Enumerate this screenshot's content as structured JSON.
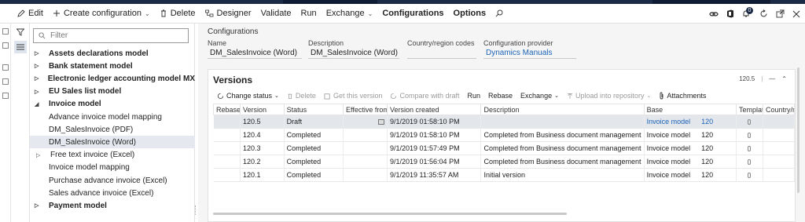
{
  "toolbar": {
    "edit": "Edit",
    "create_configuration": "Create configuration",
    "delete": "Delete",
    "designer": "Designer",
    "validate": "Validate",
    "run": "Run",
    "exchange": "Exchange",
    "configurations": "Configurations",
    "options": "Options",
    "notification_count": "0"
  },
  "filter": {
    "placeholder": "Filter"
  },
  "tree": {
    "items": [
      {
        "label": "Assets declarations model",
        "level": 0,
        "expanded": false
      },
      {
        "label": "Bank statement model",
        "level": 0,
        "expanded": false
      },
      {
        "label": "Electronic ledger accounting model MX",
        "level": 0,
        "expanded": false
      },
      {
        "label": "EU Sales list model",
        "level": 0,
        "expanded": false
      },
      {
        "label": "Invoice model",
        "level": 0,
        "expanded": true
      },
      {
        "label": "Advance invoice model mapping",
        "level": 1
      },
      {
        "label": "DM_SalesInvoice (PDF)",
        "level": 1
      },
      {
        "label": "DM_SalesInvoice (Word)",
        "level": 1,
        "selected": true
      },
      {
        "label": "Free text invoice (Excel)",
        "level": 1,
        "expandable": true
      },
      {
        "label": "Invoice model mapping",
        "level": 1
      },
      {
        "label": "Purchase advance invoice (Excel)",
        "level": 1
      },
      {
        "label": "Sales advance invoice (Excel)",
        "level": 1
      },
      {
        "label": "Payment model",
        "level": 0,
        "expanded": false
      }
    ]
  },
  "header": {
    "breadcrumb": "Configurations",
    "name_label": "Name",
    "name_value": "DM_SalesInvoice (Word)",
    "description_label": "Description",
    "description_value": "DM_SalesInvoice (Word)",
    "country_label": "Country/region codes",
    "country_value": "",
    "provider_label": "Configuration provider",
    "provider_value": "Dynamics Manuals"
  },
  "versions": {
    "title": "Versions",
    "version_badge": "120.5",
    "separator": "|",
    "dash": "—",
    "tools": {
      "change_status": "Change status",
      "delete": "Delete",
      "get_this_version": "Get this version",
      "compare_with_draft": "Compare with draft",
      "run": "Run",
      "rebase": "Rebase",
      "exchange": "Exchange",
      "upload_into_repository": "Upload into repository",
      "attachments": "Attachments"
    },
    "columns": [
      "Rebase ...",
      "Version",
      "Status",
      "Effective from",
      "Version created",
      "Description",
      "Base",
      "Template",
      "Country/reg"
    ],
    "rows": [
      {
        "version": "120.5",
        "status": "Draft",
        "created": "9/1/2019 01:58:10 PM",
        "description": "",
        "base": "Invoice model",
        "base_ver": "120",
        "selected": true
      },
      {
        "version": "120.4",
        "status": "Completed",
        "created": "9/1/2019 01:58:10 PM",
        "description": "Completed from Business document management",
        "base": "Invoice model",
        "base_ver": "120"
      },
      {
        "version": "120.3",
        "status": "Completed",
        "created": "9/1/2019 01:57:49 PM",
        "description": "Completed from Business document management",
        "base": "Invoice model",
        "base_ver": "120"
      },
      {
        "version": "120.2",
        "status": "Completed",
        "created": "9/1/2019 01:56:04 PM",
        "description": "Completed from Business document management",
        "base": "Invoice model",
        "base_ver": "120"
      },
      {
        "version": "120.1",
        "status": "Completed",
        "created": "9/1/2019 11:35:57 AM",
        "description": "Initial version",
        "base": "Invoice model",
        "base_ver": "120"
      }
    ]
  },
  "colors": {
    "accent": "#1a63b8",
    "topbar": "#1b2a47",
    "selected_row": "#e3e6eb"
  }
}
